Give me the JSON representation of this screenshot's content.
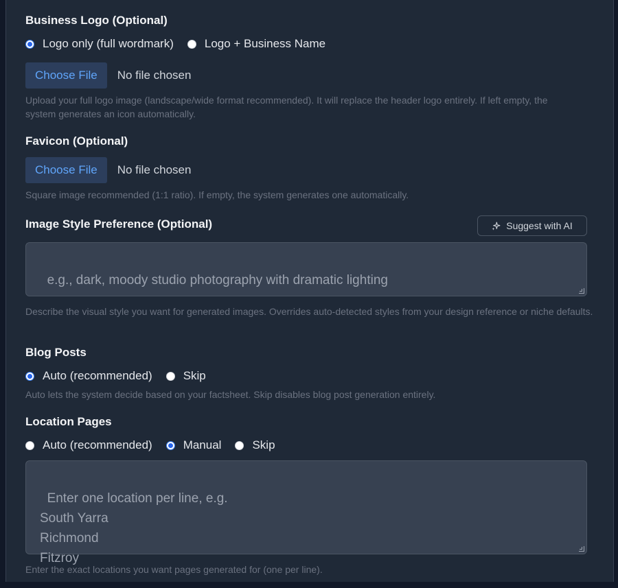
{
  "logo": {
    "label": "Business Logo (Optional)",
    "options": [
      "Logo only (full wordmark)",
      "Logo + Business Name"
    ],
    "selected": 0,
    "file_button": "Choose File",
    "file_status": "No file chosen",
    "help": "Upload your full logo image (landscape/wide format recommended). It will replace the header logo entirely. If left empty, the system generates an icon automatically."
  },
  "favicon": {
    "label": "Favicon (Optional)",
    "file_button": "Choose File",
    "file_status": "No file chosen",
    "help": "Square image recommended (1:1 ratio). If empty, the system generates one automatically."
  },
  "image_style": {
    "label": "Image Style Preference (Optional)",
    "suggest_button": "Suggest with AI",
    "suggest_icon": "sparkles-icon",
    "placeholder": "e.g., dark, moody studio photography with dramatic lighting",
    "help": "Describe the visual style you want for generated images. Overrides auto-detected styles from your design reference or niche defaults."
  },
  "blog_posts": {
    "label": "Blog Posts",
    "options": [
      "Auto (recommended)",
      "Skip"
    ],
    "selected": 0,
    "help": "Auto lets the system decide based on your factsheet. Skip disables blog post generation entirely."
  },
  "location_pages": {
    "label": "Location Pages",
    "options": [
      "Auto (recommended)",
      "Manual",
      "Skip"
    ],
    "selected": 1,
    "placeholder": "Enter one location per line, e.g.\nSouth Yarra\nRichmond\nFitzroy",
    "help": "Enter the exact locations you want pages generated for (one per line)."
  },
  "colors": {
    "background": "#1f2937",
    "accent": "#2563eb",
    "file_button_text": "#60a5fa",
    "input_bg": "#374151"
  }
}
